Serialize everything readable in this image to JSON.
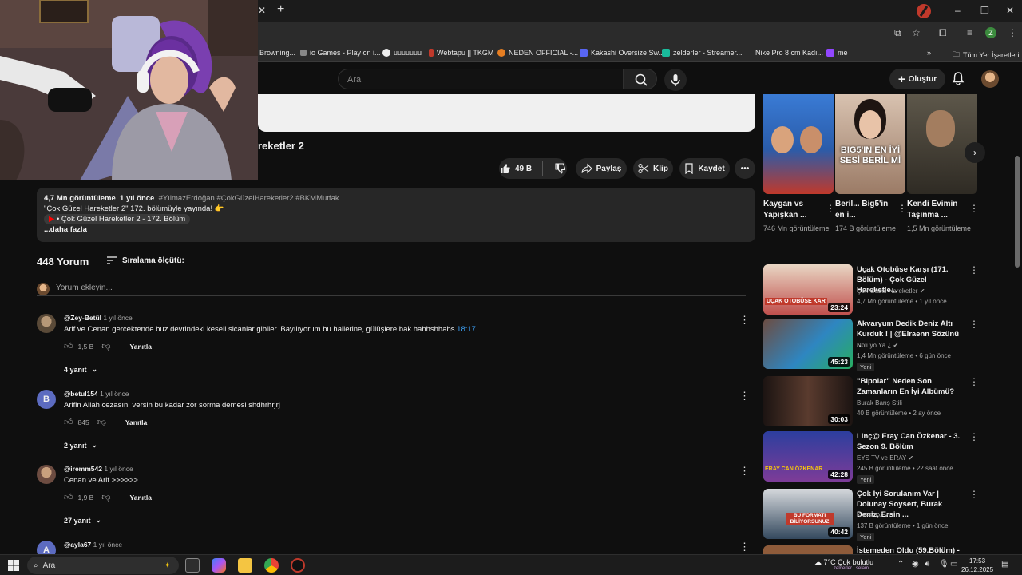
{
  "browser": {
    "bookmarks": [
      {
        "label": "Browning...",
        "icon": "blank-page-icon",
        "color": "#2b2b2b"
      },
      {
        "label": "io Games - Play on i...",
        "icon": "io-games-icon",
        "color": "#888888"
      },
      {
        "label": "uuuuuuu",
        "icon": "github-icon",
        "color": "#ffffff"
      },
      {
        "label": "Webtapu || TKGM",
        "icon": "tkgm-icon",
        "color": "#c0392b"
      },
      {
        "label": "NEDEN OFFICIAL -...",
        "icon": "neden-icon",
        "color": "#e67e22"
      },
      {
        "label": "Kakashi Oversize Sw...",
        "icon": "s-icon",
        "color": "#5865f2"
      },
      {
        "label": "zelderler - Streamer...",
        "icon": "tt-icon",
        "color": "#1abc9c"
      },
      {
        "label": "Nike Pro 8 cm Kadı...",
        "icon": "nike-icon",
        "color": "#2b2b2b"
      },
      {
        "label": "me",
        "icon": "twitch-icon",
        "color": "#9146ff"
      }
    ],
    "all_bookmarks_label": "Tüm Yer İşaretleri",
    "profile_letter": "Z"
  },
  "header": {
    "search_placeholder": "Ara",
    "create_label": "Oluştur"
  },
  "video": {
    "title_fragment": "reketler 2",
    "likes": "49 B",
    "share_label": "Paylaş",
    "clip_label": "Klip",
    "save_label": "Kaydet"
  },
  "description": {
    "views": "4,7 Mn görüntüleme",
    "age": "1 yıl önce",
    "tags": "#YılmazErdoğan #ÇokGüzelHareketler2 #BKMMutfak",
    "line1": "\"Çok Güzel Hareketler 2\" 172. bölümüyle yayında! 👉",
    "chapter": "• Çok Güzel Hareketler 2 - 172. Bölüm",
    "more": "...daha fazla"
  },
  "comments": {
    "count_label": "448 Yorum",
    "sort_label": "Sıralama ölçütü:",
    "add_placeholder": "Yorum ekleyin...",
    "reply_label": "Yanıtla",
    "items": [
      {
        "author": "@Zey-Betül",
        "time": "1 yıl önce",
        "text": "Arif ve Cenan gercektende buz devrindeki keseli sicanlar gibiler. Bayılıyorum bu hallerine, gülüşlere bak hahhshhahs",
        "timestamp": "18:17",
        "likes": "1,5 B",
        "replies": "4 yanıt",
        "avatar_color": "#7a6a55",
        "avatar_letter": ""
      },
      {
        "author": "@betul154",
        "time": "1 yıl önce",
        "text": "Arifin Allah cezasını versin bu kadar zor sorma demesi shdhrhrjrj",
        "timestamp": "",
        "likes": "845",
        "replies": "2 yanıt",
        "avatar_color": "#5c6bc0",
        "avatar_letter": "B"
      },
      {
        "author": "@iremm542",
        "time": "1 yıl önce",
        "text": "Cenan ve Arif >>>>>>",
        "timestamp": "",
        "likes": "1,9 B",
        "replies": "27 yanıt",
        "avatar_color": "#8d6e63",
        "avatar_letter": ""
      },
      {
        "author": "@ayla67",
        "time": "1 yıl önce",
        "text": "",
        "timestamp": "",
        "likes": "",
        "replies": "",
        "avatar_color": "#5c6bc0",
        "avatar_letter": "A"
      }
    ]
  },
  "shorts": [
    {
      "title": "Kaygan vs Yapışkan ...",
      "views": "746 Mn görüntüleme",
      "bg": "#3a7bd5",
      "overlay": ""
    },
    {
      "title": "Beril... Big5'in en i...",
      "views": "174 B görüntüleme",
      "bg": "#c8a68f",
      "overlay": "BIG5'IN EN İYİ SESİ BERİL Mİ"
    },
    {
      "title": "Kendi Evimin Taşınma ...",
      "views": "1,5 Mn görüntüleme",
      "bg": "#4e4a3e",
      "overlay": ""
    }
  ],
  "recommendations": [
    {
      "title": "Uçak Otobüse Karşı (171. Bölüm) - Çok Güzel Hareketle...",
      "channel": "Çok Güzel Hareketler",
      "verified": true,
      "meta": "4,7 Mn görüntüleme • 1 yıl önce",
      "duration": "23:24",
      "badge": "",
      "thumb_color": "#c0504d",
      "thumb_text": "UÇAK OTOBÜSE KAR"
    },
    {
      "title": "Akvaryum Dedik Deniz Altı Kurduk ! | @Elraenn Sözünü ...",
      "channel": "Noluyo Ya ¿",
      "verified": true,
      "meta": "1,4 Mn görüntüleme • 6 gün önce",
      "duration": "45:23",
      "badge": "Yeni",
      "thumb_color": "#2e86c1",
      "thumb_text": ""
    },
    {
      "title": "\"Bipolar\" Neden Son Zamanların En İyi Albümü?",
      "channel": "Burak Barış Stili",
      "verified": false,
      "meta": "40 B görüntüleme • 2 ay önce",
      "duration": "30:03",
      "badge": "",
      "thumb_color": "#3b2a24",
      "thumb_text": ""
    },
    {
      "title": "Linç@ Eray Can Özkenar - 3. Sezon 9. Bölüm",
      "channel": "EYS TV ve ERAY",
      "verified": true,
      "meta": "245 B görüntüleme • 22 saat önce",
      "duration": "42:28",
      "badge": "Yeni",
      "thumb_color": "#7d3c98",
      "thumb_text": "ERAY CAN ÖZKENAR"
    },
    {
      "title": "Çok İyi Sorulanım Var | Dolunay Soysert, Burak Deniz, Ersin ...",
      "channel": "KAFA TV",
      "verified": true,
      "meta": "137 B görüntüleme • 1 gün önce",
      "duration": "40:42",
      "badge": "Yeni",
      "thumb_color": "#34495e",
      "thumb_text": "BU FORMATI BİLİYORSUNUZ"
    },
    {
      "title": "İstemeden Oldu (59.Bölüm) -",
      "channel": "",
      "verified": false,
      "meta": "",
      "duration": "",
      "badge": "",
      "thumb_color": "#8e5b3a",
      "thumb_text": ""
    }
  ],
  "taskbar": {
    "search_placeholder": "Ara",
    "weather": "7°C  Çok bulutlu",
    "ticker": "zelderler : selam",
    "time": "17:53",
    "date": "26.12.2025"
  }
}
